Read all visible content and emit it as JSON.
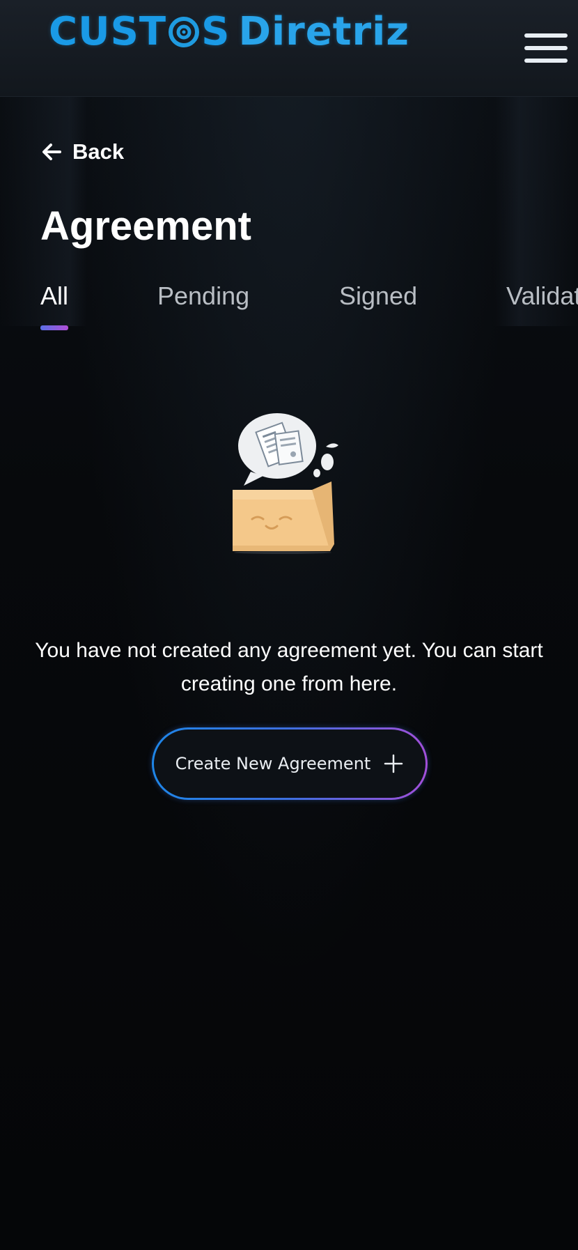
{
  "header": {
    "brand_part_1": "CUST",
    "brand_part_1b": "S",
    "brand_part_2": "Diretriz",
    "logo_icon": "target-icon",
    "menu_icon": "hamburger-menu-icon"
  },
  "nav": {
    "back_label": "Back",
    "back_icon": "arrow-left-icon"
  },
  "page": {
    "title": "Agreement"
  },
  "tabs": [
    {
      "label": "All",
      "active": true
    },
    {
      "label": "Pending",
      "active": false
    },
    {
      "label": "Signed",
      "active": false
    },
    {
      "label": "Validated",
      "active": false
    }
  ],
  "empty_state": {
    "illustration": "empty-folder-document-illustration",
    "message": "You have not created any agreement yet. You can start creating one from here."
  },
  "create_button": {
    "label": "Create New Agreement",
    "icon": "plus-icon"
  },
  "colors": {
    "brand": "#1f9be0",
    "accent_gradient_start": "#1e86e8",
    "accent_gradient_end": "#a24fd9",
    "background": "#06080b"
  }
}
